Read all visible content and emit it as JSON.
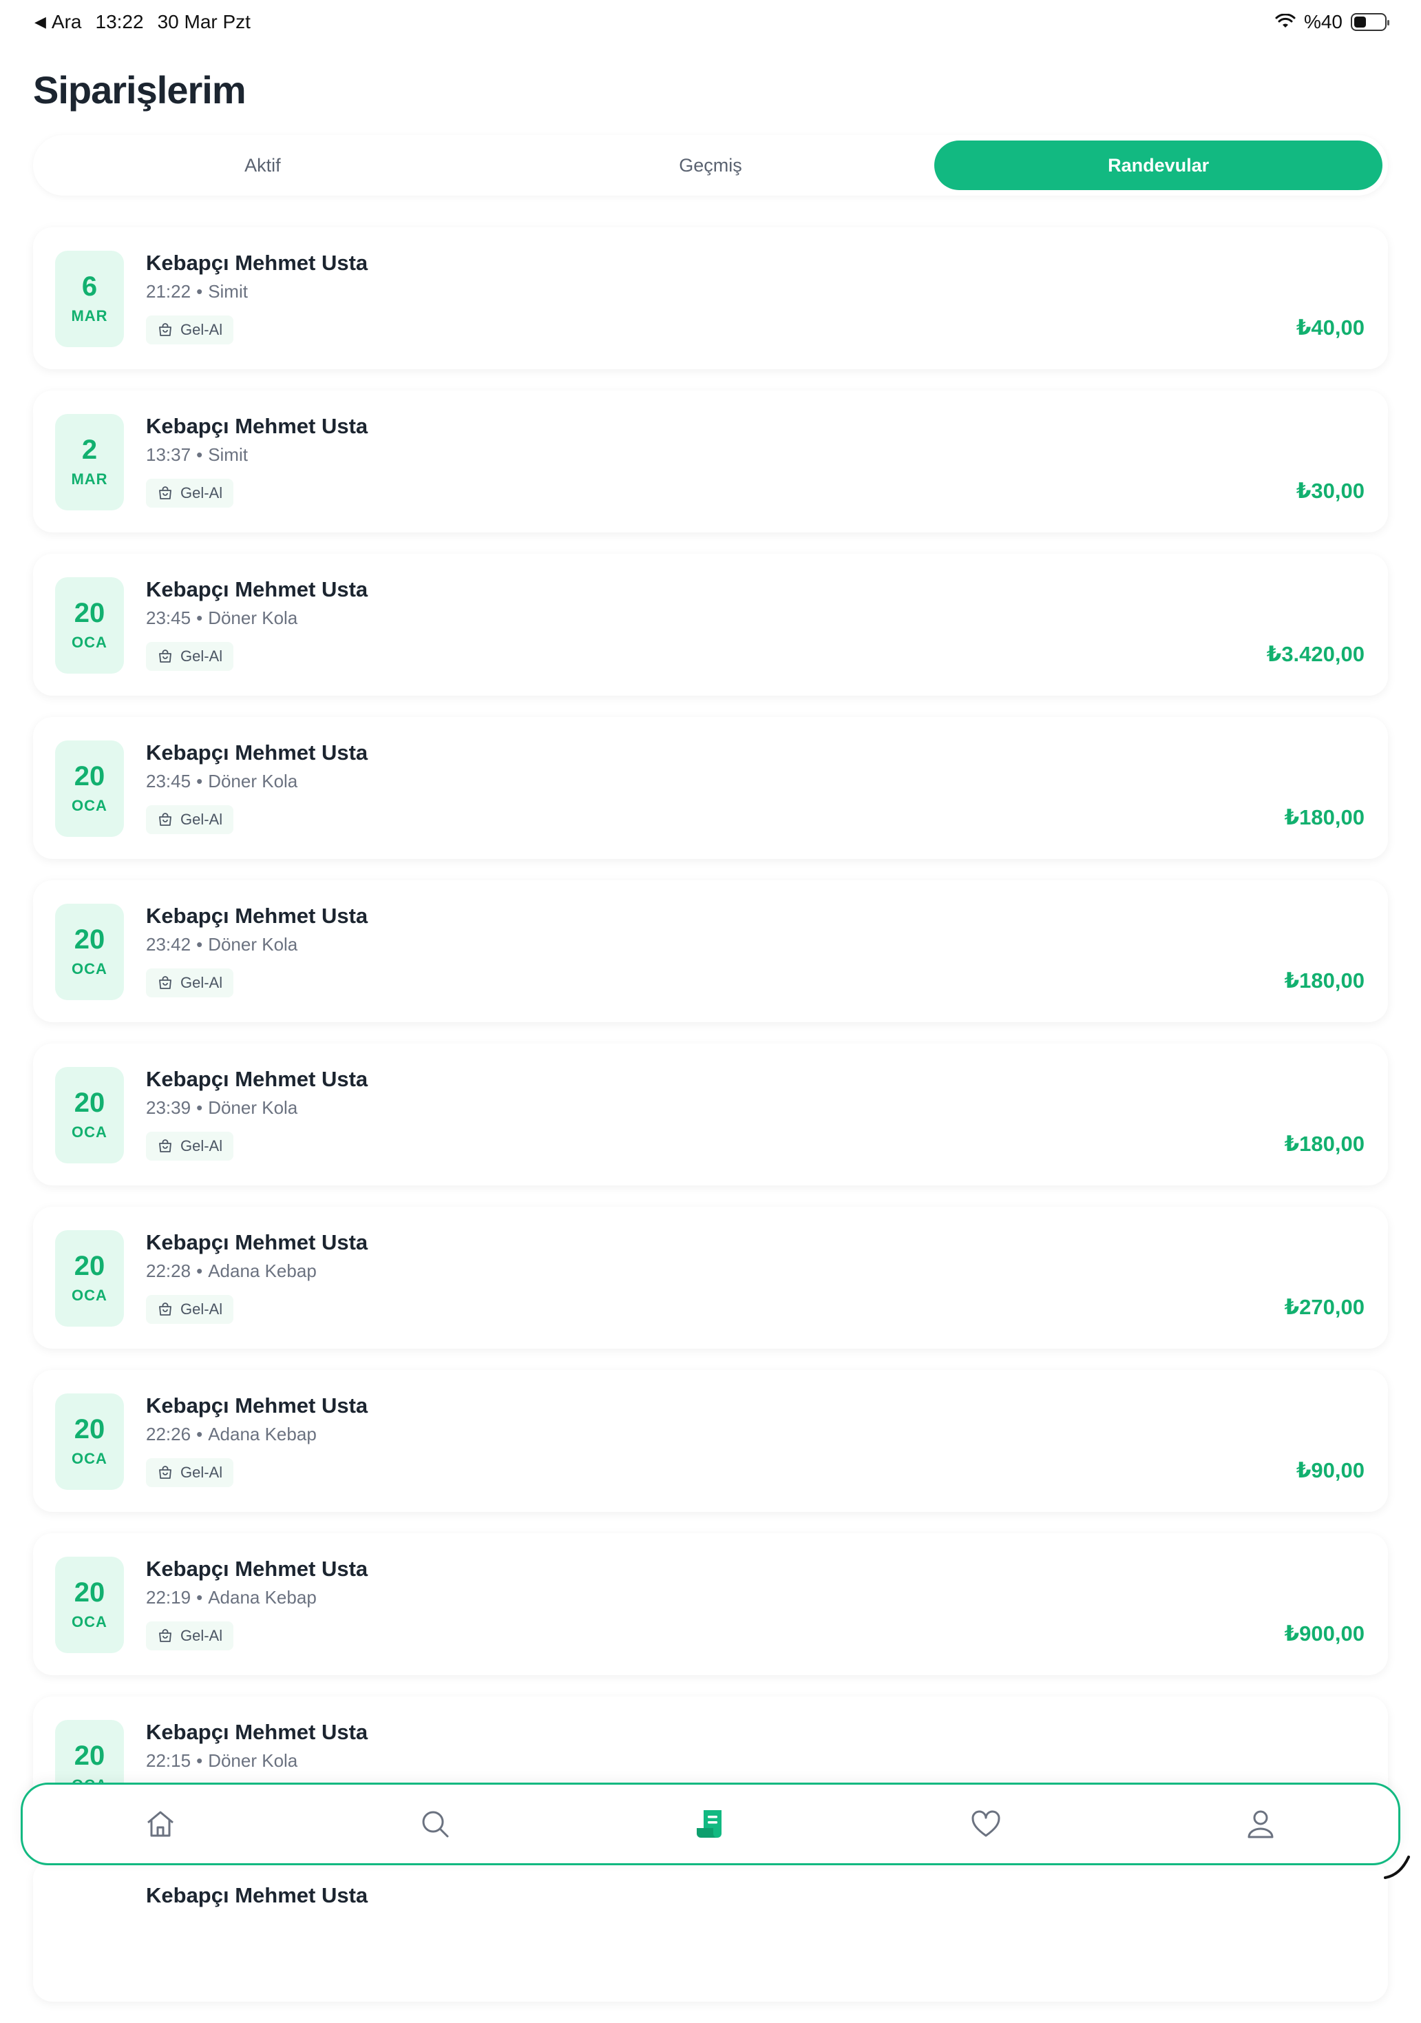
{
  "status_bar": {
    "back_label": "Ara",
    "time": "13:22",
    "date": "30 Mar Pzt",
    "battery": "%40",
    "battery_level": 0.4
  },
  "page": {
    "title": "Siparişlerim"
  },
  "tabs": [
    {
      "label": "Aktif",
      "active": false
    },
    {
      "label": "Geçmiş",
      "active": false
    },
    {
      "label": "Randevular",
      "active": true
    }
  ],
  "orders": [
    {
      "day": "6",
      "month": "MAR",
      "name": "Kebapçı Mehmet Usta",
      "time": "21:22",
      "item": "Simit",
      "badge": "Gel-Al",
      "price": "₺40,00"
    },
    {
      "day": "2",
      "month": "MAR",
      "name": "Kebapçı Mehmet Usta",
      "time": "13:37",
      "item": "Simit",
      "badge": "Gel-Al",
      "price": "₺30,00"
    },
    {
      "day": "20",
      "month": "OCA",
      "name": "Kebapçı Mehmet Usta",
      "time": "23:45",
      "item": "Döner Kola",
      "badge": "Gel-Al",
      "price": "₺3.420,00"
    },
    {
      "day": "20",
      "month": "OCA",
      "name": "Kebapçı Mehmet Usta",
      "time": "23:45",
      "item": "Döner Kola",
      "badge": "Gel-Al",
      "price": "₺180,00"
    },
    {
      "day": "20",
      "month": "OCA",
      "name": "Kebapçı Mehmet Usta",
      "time": "23:42",
      "item": "Döner Kola",
      "badge": "Gel-Al",
      "price": "₺180,00"
    },
    {
      "day": "20",
      "month": "OCA",
      "name": "Kebapçı Mehmet Usta",
      "time": "23:39",
      "item": "Döner Kola",
      "badge": "Gel-Al",
      "price": "₺180,00"
    },
    {
      "day": "20",
      "month": "OCA",
      "name": "Kebapçı Mehmet Usta",
      "time": "22:28",
      "item": "Adana Kebap",
      "badge": "Gel-Al",
      "price": "₺270,00"
    },
    {
      "day": "20",
      "month": "OCA",
      "name": "Kebapçı Mehmet Usta",
      "time": "22:26",
      "item": "Adana Kebap",
      "badge": "Gel-Al",
      "price": "₺90,00"
    },
    {
      "day": "20",
      "month": "OCA",
      "name": "Kebapçı Mehmet Usta",
      "time": "22:19",
      "item": "Adana Kebap",
      "badge": "Gel-Al",
      "price": "₺900,00"
    },
    {
      "day": "20",
      "month": "OCA",
      "name": "Kebapçı Mehmet Usta",
      "time": "22:15",
      "item": "Döner Kola",
      "badge": "",
      "price": ""
    },
    {
      "day": "",
      "month": "",
      "name": "Kebapçı Mehmet Usta",
      "time": "",
      "item": "",
      "badge": "",
      "price": ""
    }
  ],
  "bottom_nav": [
    {
      "icon": "home-icon",
      "active": false
    },
    {
      "icon": "search-icon",
      "active": false
    },
    {
      "icon": "orders-receipt-icon",
      "active": true
    },
    {
      "icon": "heart-icon",
      "active": false
    },
    {
      "icon": "profile-icon",
      "active": false
    }
  ],
  "colors": {
    "accent": "#12b981",
    "price": "#12b06f",
    "date_bg": "#e3f9ef",
    "text_dark": "#1c2530",
    "text_muted": "#6b7280",
    "icon_gray": "#6b7280"
  }
}
